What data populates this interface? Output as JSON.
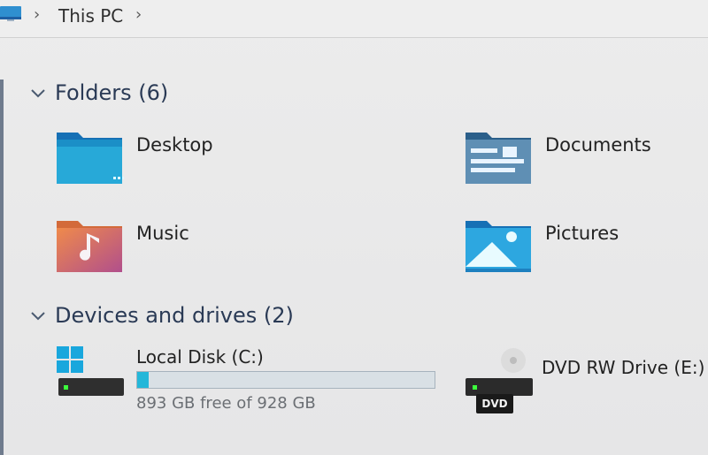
{
  "breadcrumb": {
    "items": [
      "This PC"
    ],
    "icon": "this-pc-icon"
  },
  "folders": {
    "heading": "Folders (6)",
    "items": [
      {
        "label": "Desktop",
        "icon": "desktop-folder-icon"
      },
      {
        "label": "Documents",
        "icon": "documents-folder-icon"
      },
      {
        "label": "Music",
        "icon": "music-folder-icon"
      },
      {
        "label": "Pictures",
        "icon": "pictures-folder-icon"
      }
    ]
  },
  "devices": {
    "heading": "Devices and drives (2)",
    "items": [
      {
        "label": "Local Disk (C:)",
        "icon": "windows-drive-icon",
        "free_text": "893 GB free of 928 GB",
        "used_fraction": 0.0377
      },
      {
        "label": "DVD RW Drive (E:)",
        "icon": "dvd-drive-icon",
        "badge": "DVD"
      }
    ]
  },
  "colors": {
    "accent": "#24b7d9",
    "heading": "#2a3a55"
  }
}
